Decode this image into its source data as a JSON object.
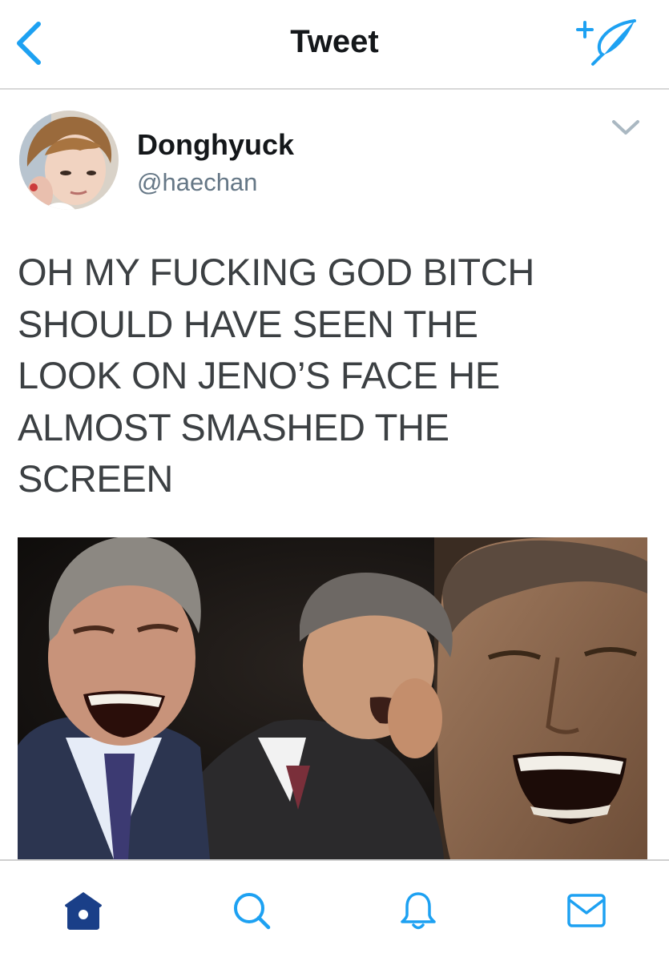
{
  "navbar": {
    "title": "Tweet",
    "back_icon": "chevron-left-icon",
    "compose_icon": "compose-tweet-icon",
    "accent_color": "#1da1f2"
  },
  "tweet": {
    "display_name": "Donghyuck",
    "handle": "@haechan",
    "text_lines": [
      "OH MY FUCKING GOD BITCH",
      "SHOULD HAVE SEEN THE",
      "LOOK ON JENO’S FACE HE",
      "ALMOST SMASHED THE",
      "SCREEN"
    ],
    "menu_icon": "chevron-down-icon",
    "media": "photo of three laughing men in suits against a dark background"
  },
  "tabbar": {
    "tabs": [
      {
        "name": "home",
        "icon": "home-icon",
        "active": true
      },
      {
        "name": "search",
        "icon": "search-icon",
        "active": false
      },
      {
        "name": "notifications",
        "icon": "bell-icon",
        "active": false
      },
      {
        "name": "messages",
        "icon": "envelope-icon",
        "active": false
      }
    ],
    "active_color": "#1a3f88",
    "inactive_color": "#1da1f2"
  }
}
